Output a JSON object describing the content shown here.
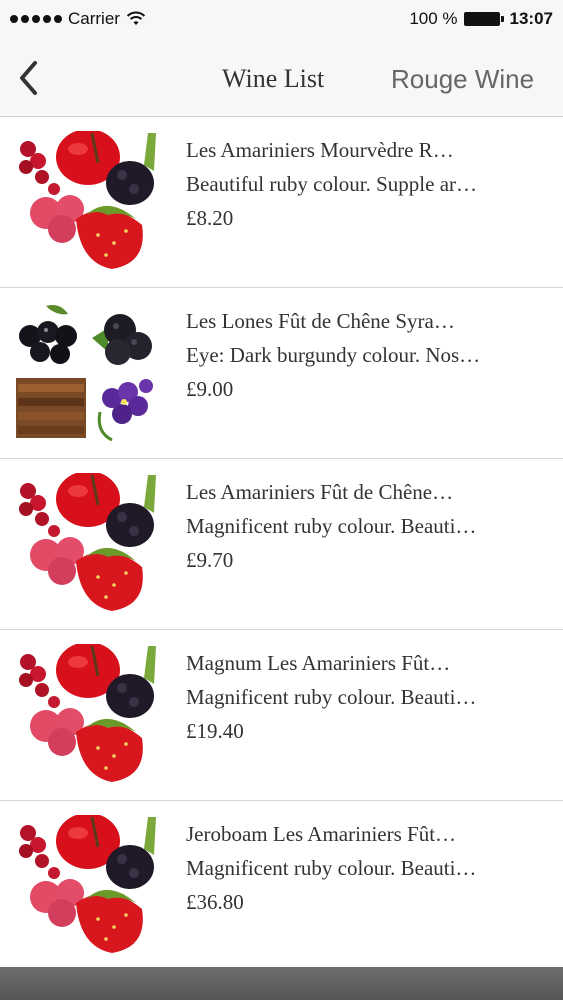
{
  "status_bar": {
    "carrier": "Carrier",
    "battery": "100 %",
    "time": "13:07"
  },
  "nav": {
    "back_icon": "chevron-left-icon",
    "title": "Wine List",
    "right_label": "Rouge Wine"
  },
  "wines": [
    {
      "name": "Les Amariniers Mourvèdre R…",
      "description": "Beautiful ruby colour. Supple ar…",
      "price": "£8.20",
      "image": "red-fruits-image"
    },
    {
      "name": "Les Lones Fût de Chêne Syra…",
      "description": "Eye: Dark burgundy colour. Nos…",
      "price": "£9.00",
      "image": "dark-fruits-spice-violet-image"
    },
    {
      "name": "Les Amariniers Fût de Chêne…",
      "description": "Magnificent ruby colour. Beauti…",
      "price": "£9.70",
      "image": "red-fruits-image"
    },
    {
      "name": "Magnum Les Amariniers Fût…",
      "description": "Magnificent ruby colour. Beauti…",
      "price": "£19.40",
      "image": "red-fruits-image"
    },
    {
      "name": "Jeroboam Les Amariniers Fût…",
      "description": "Magnificent ruby colour. Beauti…",
      "price": "£36.80",
      "image": "red-fruits-image"
    }
  ]
}
